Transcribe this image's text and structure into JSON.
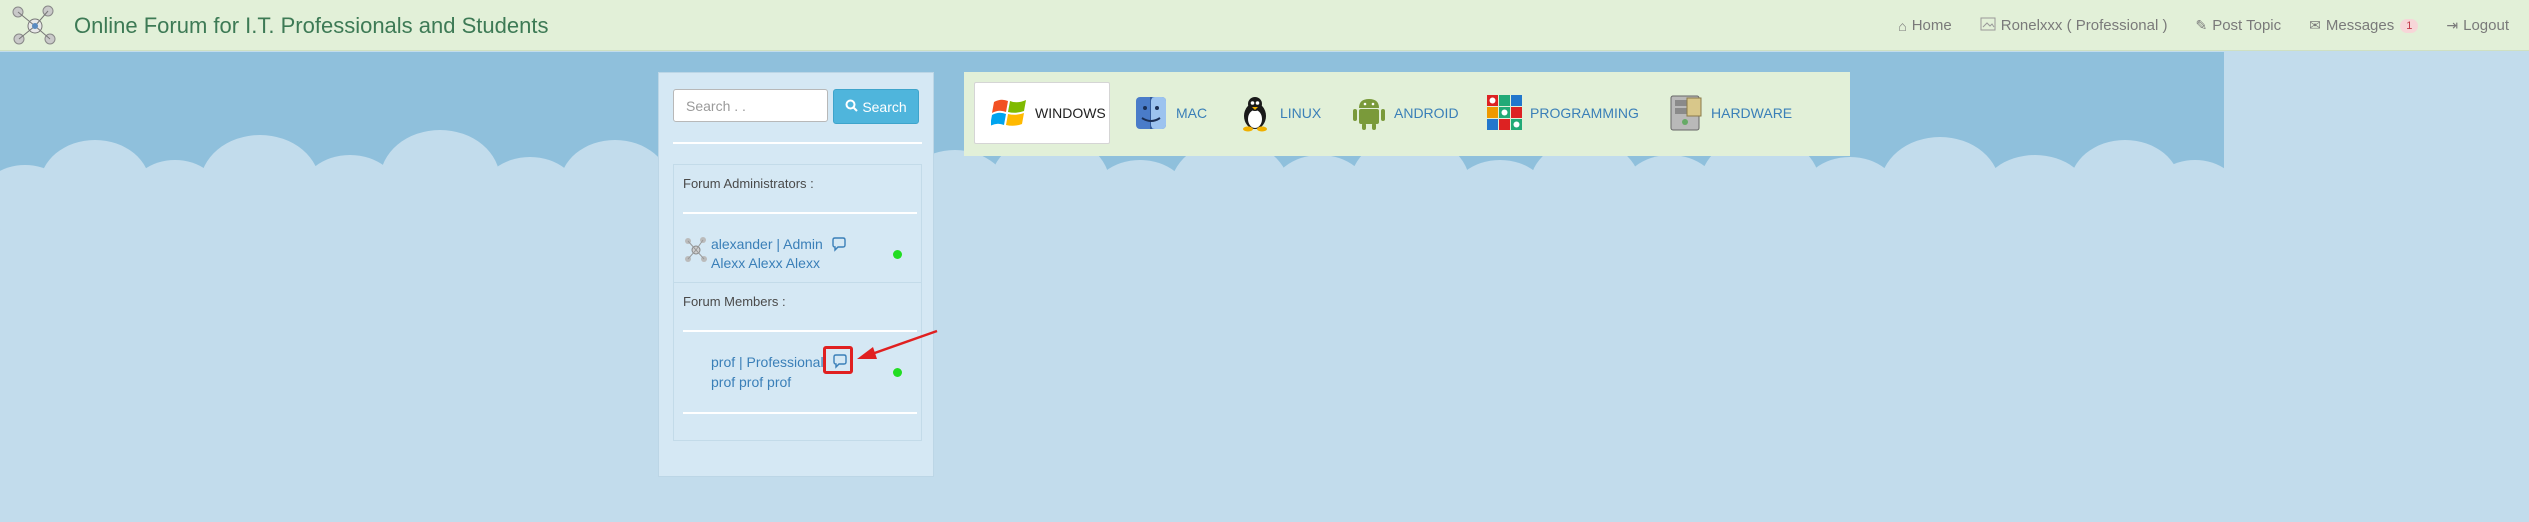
{
  "navbar": {
    "title": "Online Forum for I.T. Professionals and Students",
    "links": [
      {
        "label": "Home",
        "icon": "home-icon"
      },
      {
        "label": "Ronelxxx ( Professional )",
        "icon": "broken-image-icon"
      },
      {
        "label": "Post Topic",
        "icon": "edit-icon"
      },
      {
        "label": "Messages",
        "icon": "envelope-icon",
        "badge": "1"
      },
      {
        "label": "Logout",
        "icon": "logout-icon"
      }
    ]
  },
  "sidebar": {
    "search": {
      "placeholder": "Search . .",
      "value": "",
      "button_label": "Search"
    },
    "admins_label": "Forum Administrators :",
    "admins": [
      {
        "name": "alexander | Admin",
        "full_name": "Alexx Alexx Alexx",
        "online": true
      }
    ],
    "members_label": "Forum Members :",
    "members": [
      {
        "name": "prof | Professional",
        "full_name": "prof prof prof",
        "online": true
      }
    ]
  },
  "categories": [
    {
      "label": "WINDOWS",
      "icon": "windows-logo-icon",
      "active": true
    },
    {
      "label": "MAC",
      "icon": "mac-finder-icon",
      "active": false
    },
    {
      "label": "LINUX",
      "icon": "linux-penguin-icon",
      "active": false
    },
    {
      "label": "ANDROID",
      "icon": "android-robot-icon",
      "active": false
    },
    {
      "label": "PROGRAMMING",
      "icon": "programming-blocks-icon",
      "active": false
    },
    {
      "label": "HARDWARE",
      "icon": "hardware-case-icon",
      "active": false
    }
  ],
  "colors": {
    "navbar_bg": "#e2f0d8",
    "brand_text": "#3d7a55",
    "link_blue": "#3a7fb8",
    "search_button": "#4fb5dc",
    "online": "#22dd22",
    "annotation_red": "#e02020"
  }
}
